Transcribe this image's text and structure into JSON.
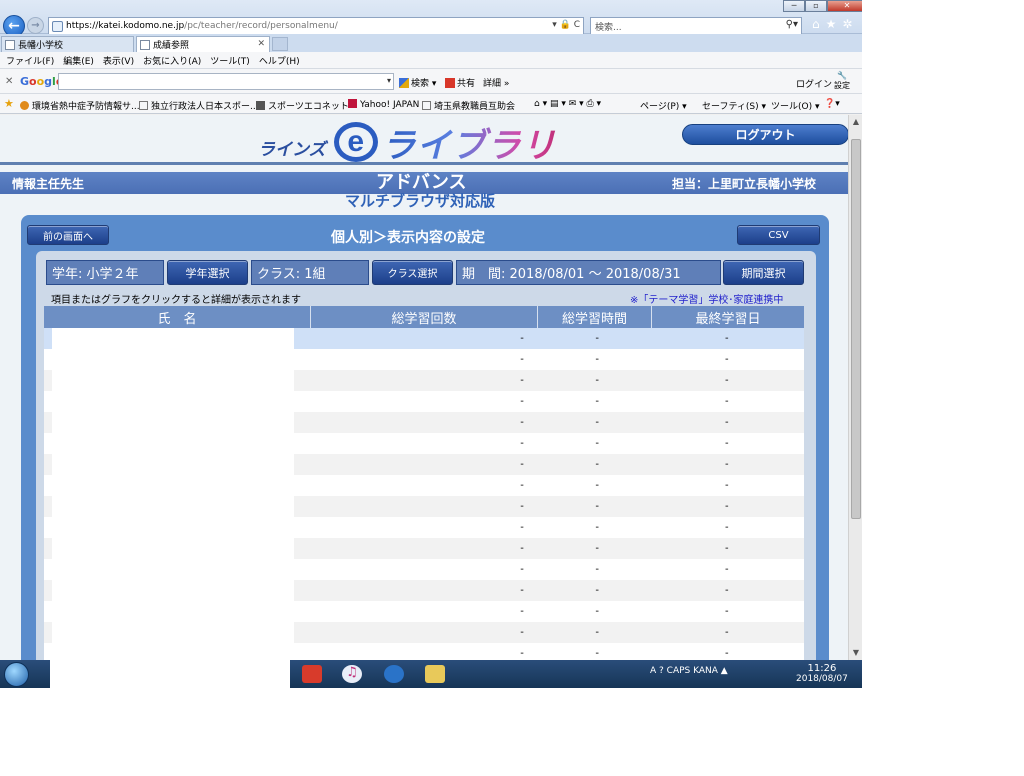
{
  "browser": {
    "url_host": "https://katei.kodomo.ne.jp",
    "url_path": "/pc/teacher/record/personalmenu/",
    "url_tools": "▾ 🔒 C",
    "search_placeholder": "検索...",
    "tabs": [
      {
        "label": "長幡小学校"
      },
      {
        "label": "成績参照"
      }
    ],
    "menu": [
      "ファイル(F)",
      "編集(E)",
      "表示(V)",
      "お気に入り(A)",
      "ツール(T)",
      "ヘルプ(H)"
    ],
    "google": {
      "search_label": "検索",
      "share_label": "共有",
      "detail_label": "詳細 »",
      "login_label": "ログイン",
      "settings_label": "設定"
    },
    "favorites": [
      "環境省熱中症予防情報サ...",
      "独立行政法人日本スポー...",
      "スポーツエコネット",
      "Yahoo! JAPAN",
      "埼玉県教職員互助会"
    ],
    "commands": [
      "ページ(P) ▾",
      "セーフティ(S) ▾",
      "ツール(O) ▾"
    ]
  },
  "site": {
    "logo_small": "ラインズ",
    "logo_e": "e",
    "logo_big": "ライブラリ",
    "logout_label": "ログアウト",
    "teacher": "情報主任先生",
    "advance": "アドバンス",
    "multi": "マルチブラウザ対応版",
    "charge": "担当：上里町立長幡小学校"
  },
  "panel": {
    "back_label": "前の画面へ",
    "title": "個人別＞表示内容の設定",
    "csv_label": "CSV",
    "grade_text": "学年: 小学２年",
    "grade_btn": "学年選択",
    "class_text": "クラス: 1組",
    "class_btn": "クラス選択",
    "period_text": "期　間: 2018/08/01 ～ 2018/08/31",
    "period_btn": "期間選択",
    "hint": "項目またはグラフをクリックすると詳細が表示されます",
    "theme_note": "※「テーマ学習」学校･家庭連携中"
  },
  "table": {
    "headers": [
      "氏　名",
      "総学習回数",
      "総学習時間",
      "最終学習日"
    ],
    "rows": [
      {
        "name": "",
        "count": "-",
        "time": "-",
        "last": "-"
      },
      {
        "name": "",
        "count": "-",
        "time": "-",
        "last": "-"
      },
      {
        "name": "",
        "count": "-",
        "time": "-",
        "last": "-"
      },
      {
        "name": "",
        "count": "-",
        "time": "-",
        "last": "-"
      },
      {
        "name": "",
        "count": "-",
        "time": "-",
        "last": "-"
      },
      {
        "name": "",
        "count": "-",
        "time": "-",
        "last": "-"
      },
      {
        "name": "",
        "count": "-",
        "time": "-",
        "last": "-"
      },
      {
        "name": "",
        "count": "-",
        "time": "-",
        "last": "-"
      },
      {
        "name": "",
        "count": "-",
        "time": "-",
        "last": "-"
      },
      {
        "name": "",
        "count": "-",
        "time": "-",
        "last": "-"
      },
      {
        "name": "",
        "count": "-",
        "time": "-",
        "last": "-"
      },
      {
        "name": "",
        "count": "-",
        "time": "-",
        "last": "-"
      },
      {
        "name": "",
        "count": "-",
        "time": "-",
        "last": "-"
      },
      {
        "name": "",
        "count": "-",
        "time": "-",
        "last": "-"
      },
      {
        "name": "",
        "count": "-",
        "time": "-",
        "last": "-"
      },
      {
        "name": "",
        "count": "-",
        "time": "-",
        "last": "-"
      }
    ]
  },
  "taskbar": {
    "tray_text": "A ? CAPS KANA ▲",
    "time": "11:26",
    "date": "2018/08/07"
  },
  "colors": {
    "header_blue": "#4b6fb5",
    "panel_blue": "#5a8ccc",
    "selected_row": "#cfe0f7",
    "note_blue": "#2222cc"
  }
}
